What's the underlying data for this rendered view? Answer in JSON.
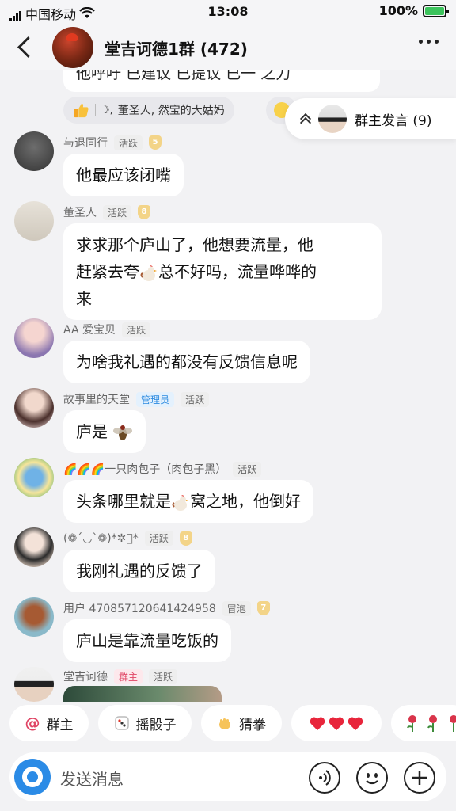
{
  "status_bar": {
    "carrier": "中国移动",
    "time": "13:08",
    "battery": "100%"
  },
  "header": {
    "title": "堂吉诃德1群 (472)"
  },
  "previous_message": {
    "text": "他呼吁 已建议 已提议 已一 之力"
  },
  "reactions": {
    "names": "董圣人, 然宝的大姑妈"
  },
  "owner_float": {
    "label": "群主发言 (9)"
  },
  "messages": [
    {
      "name": "与退同行",
      "tag": "活跃",
      "level": "5",
      "text": "他最应该闭嘴"
    },
    {
      "name": "董圣人",
      "tag": "活跃",
      "level": "8",
      "text_line1": "求求那个庐山了，他想要流量，他",
      "text_line2a": "赶紧去夸",
      "text_line2b": "总不好吗，流量哗哗的",
      "text_line3": "来"
    },
    {
      "name": "AA 爱宝贝",
      "tag": "活跃",
      "text": "为啥我礼遇的都没有反馈信息呢"
    },
    {
      "name": "故事里的天堂",
      "tag": "管理员",
      "tag2": "活跃",
      "text": "庐是"
    },
    {
      "name": "🌈🌈🌈一只肉包子（肉包子黑）",
      "tag": "活跃",
      "text_a": "头条哪里就是",
      "text_b": "窝之地，他倒好"
    },
    {
      "name": "(❁´◡`❁)*✲ﾟ*",
      "tag": "活跃",
      "level": "8",
      "text": "我刚礼遇的反馈了"
    },
    {
      "name": "用户 470857120641424958",
      "tag": "冒泡",
      "level": "7",
      "text": "庐山是靠流量吃饭的"
    },
    {
      "name": "堂吉诃德",
      "tag": "群主",
      "tag2": "活跃"
    }
  ],
  "quick_actions": {
    "at": "@",
    "owner": "群主",
    "dice": "摇骰子",
    "rps": "猜拳"
  },
  "input": {
    "placeholder": "发送消息"
  },
  "colors": {
    "accent_blue": "#2b8be6",
    "owner_pink": "#e04565",
    "bubble_bg": "#ffffff",
    "page_bg": "#f2f2f4"
  }
}
